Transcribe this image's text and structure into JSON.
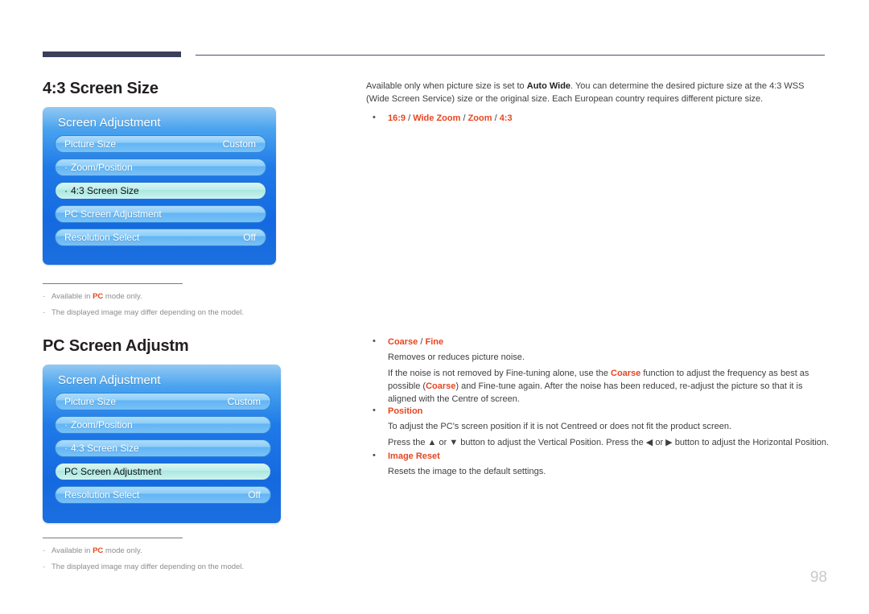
{
  "page": {
    "number": "98"
  },
  "sections": [
    {
      "heading": "4:3 Screen Size",
      "osd": {
        "title": "Screen Adjustment",
        "rows": [
          {
            "dot": "",
            "label": "Picture Size",
            "value": "Custom",
            "selected": false
          },
          {
            "dot": "·",
            "label": "Zoom/Position",
            "value": "",
            "selected": false
          },
          {
            "dot": "·",
            "label": "4:3 Screen Size",
            "value": "",
            "selected": true
          },
          {
            "dot": "",
            "label": "PC Screen Adjustment",
            "value": "",
            "selected": false
          },
          {
            "dot": "",
            "label": "Resolution Select",
            "value": "Off",
            "selected": false
          }
        ]
      },
      "footnotes": [
        {
          "pre": "Available in ",
          "hl": "PC",
          "post": " mode only."
        },
        {
          "pre": "The displayed image may differ depending on the model.",
          "hl": "",
          "post": ""
        }
      ]
    },
    {
      "heading": "PC Screen Adjustm",
      "osd": {
        "title": "Screen Adjustment",
        "rows": [
          {
            "dot": "",
            "label": "Picture Size",
            "value": "Custom",
            "selected": false
          },
          {
            "dot": "·",
            "label": "Zoom/Position",
            "value": "",
            "selected": false
          },
          {
            "dot": "·",
            "label": "4:3 Screen Size",
            "value": "",
            "selected": false
          },
          {
            "dot": "",
            "label": "PC Screen Adjustment",
            "value": "",
            "selected": true
          },
          {
            "dot": "",
            "label": "Resolution Select",
            "value": "Off",
            "selected": false
          }
        ]
      },
      "footnotes": [
        {
          "pre": "Available in ",
          "hl": "PC",
          "post": " mode only."
        },
        {
          "pre": "The displayed image may differ depending on the model.",
          "hl": "",
          "post": ""
        }
      ]
    }
  ],
  "right_column": {
    "intro_part1": "Available only when picture size is set to ",
    "intro_bold": "Auto Wide",
    "intro_part2": ". You can determine the desired picture size at the 4:3 WSS (Wide Screen Service) size or the original size. Each European country requires different picture size.",
    "option_bullet": {
      "v1": "16:9",
      "s1": " / ",
      "v2": "Wide Zoom",
      "s2": " / ",
      "v3": "Zoom",
      "s3": " / ",
      "v4": "4:3"
    },
    "coarse": {
      "term1": "Coarse",
      "sep": " / ",
      "term2": "Fine",
      "line1": "Removes or reduces picture noise.",
      "line2_a": "If the noise is not removed by Fine-tuning alone, use the ",
      "line2_hl1": "Coarse",
      "line2_b": " function to adjust the frequency as best as possible (",
      "line2_hl2": "Coarse",
      "line2_c": ") and Fine-tune again. After the noise has been reduced, re-adjust the picture so that it is aligned with the Centre of screen."
    },
    "position": {
      "term": "Position",
      "line1": "To adjust the PC's screen position if it is not Centreed or does not fit the product screen.",
      "line2_a": "Press the ",
      "up_arrow": "▲",
      "line2_b": " or ",
      "down_arrow": "▼",
      "line2_c": " button to adjust the Vertical Position. Press the ",
      "left_arrow": "◀",
      "line2_d": " or ",
      "right_arrow": "▶",
      "line2_e": " button to adjust the Horizontal Position."
    },
    "image_reset": {
      "term": "Image Reset",
      "line1": "Resets the image to the default settings."
    }
  }
}
